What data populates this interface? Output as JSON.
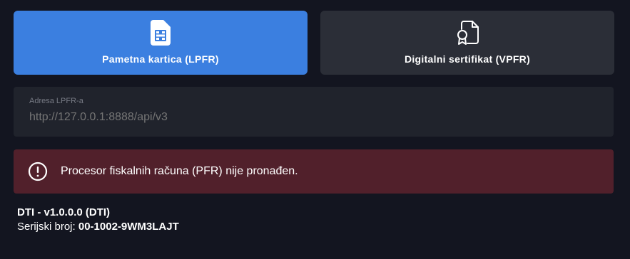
{
  "modes": {
    "lpfr": {
      "label": "Pametna kartica (LPFR)",
      "icon": "sim-card-icon",
      "active": true
    },
    "vpfr": {
      "label": "Digitalni sertifikat (VPFR)",
      "icon": "certificate-icon",
      "active": false
    }
  },
  "address_field": {
    "label": "Adresa LPFR-a",
    "placeholder": "http://127.0.0.1:8888/api/v3",
    "value": ""
  },
  "alert": {
    "icon": "exclamation-circle-icon",
    "message": "Procesor fiskalnih računa (PFR) nije pronađen."
  },
  "info": {
    "version": "DTI - v1.0.0.0 (DTI)",
    "serial_label": "Serijski broj:",
    "serial_value": "00-1002-9WM3LAJT"
  },
  "colors": {
    "background": "#131520",
    "active_button": "#3b7fe0",
    "inactive_button": "#2b2e37",
    "field_background": "#20232c",
    "alert_background": "#51202b"
  }
}
